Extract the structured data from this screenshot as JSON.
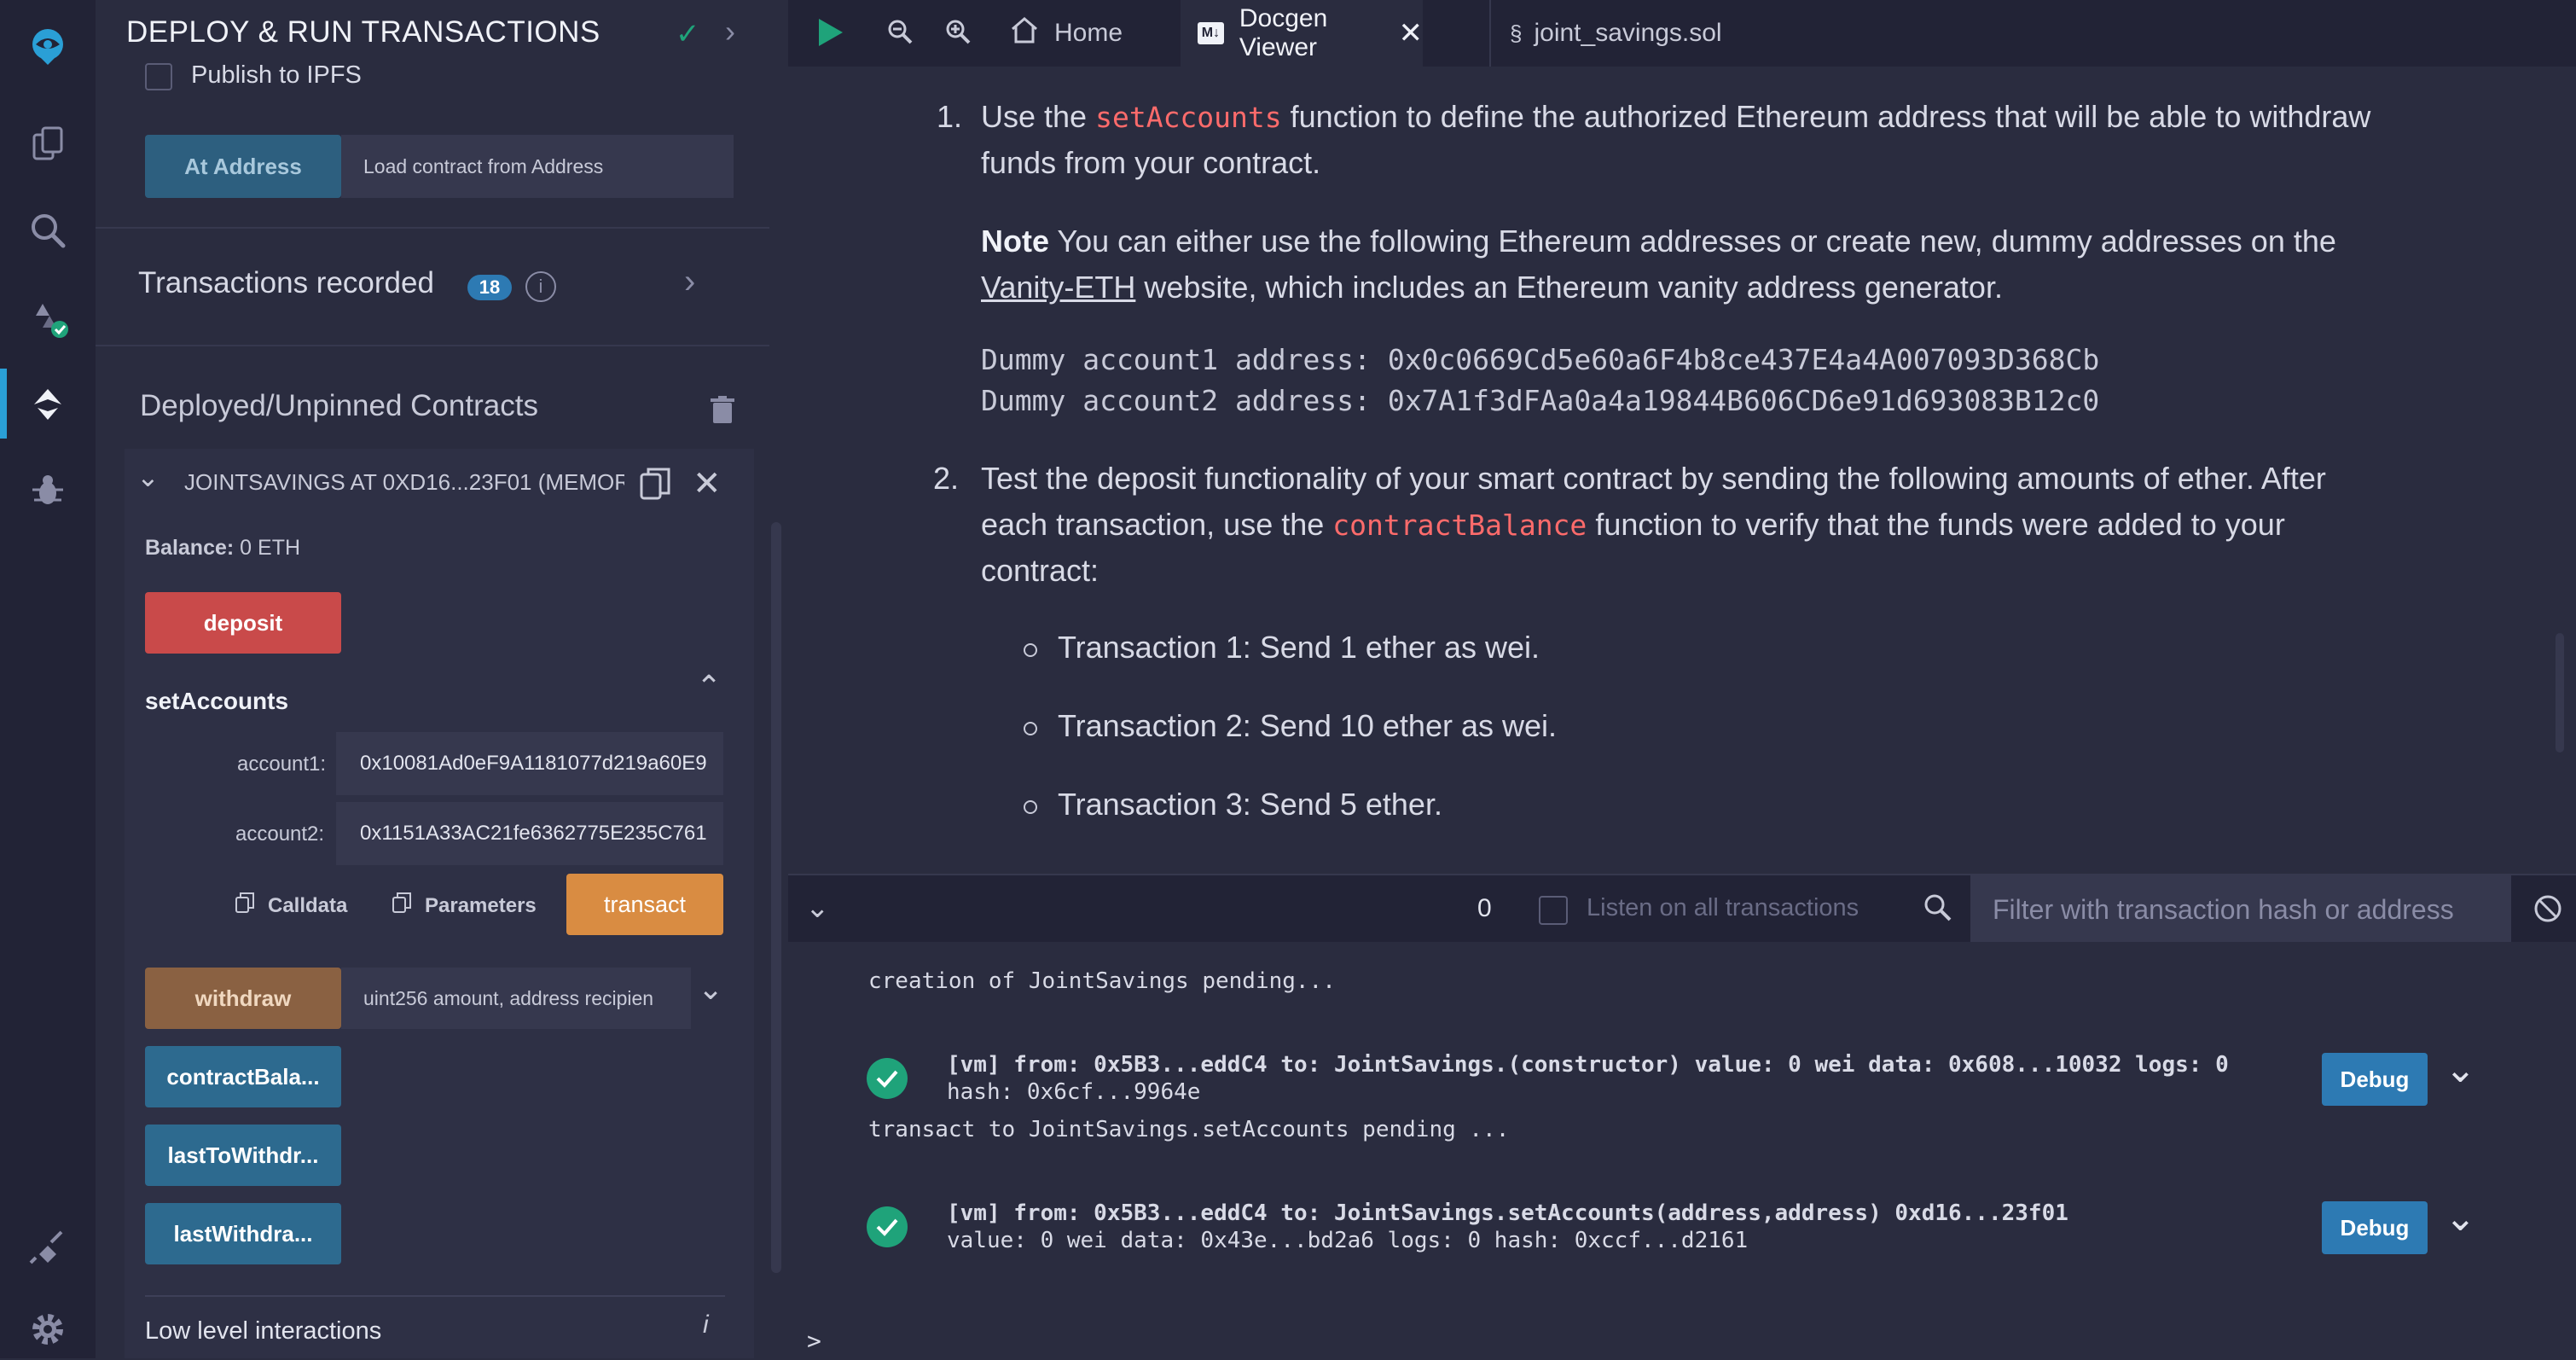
{
  "colors": {
    "accent": "#2a9fd6",
    "danger": "#c94a4a",
    "warning": "#d98c42",
    "success": "#1fa37a",
    "code": "#ff6b6b"
  },
  "rail": {
    "icons": [
      "remix-logo-icon",
      "file-explorer-icon",
      "search-icon",
      "solidity-compiler-icon",
      "deploy-run-icon",
      "debugger-icon",
      "plugin-manager-icon",
      "settings-icon"
    ]
  },
  "panel": {
    "title": "DEPLOY & RUN TRANSACTIONS",
    "publish_ipfs": "Publish to IPFS",
    "at_address_button": "At Address",
    "at_address_placeholder": "Load contract from Address",
    "transactions_recorded": "Transactions recorded",
    "transactions_count": "18",
    "deployed_title": "Deployed/Unpinned Contracts",
    "instance_title": "JOINTSAVINGS AT 0XD16...23F01 (MEMOR",
    "balance_label": "Balance:",
    "balance_value": "0 ETH",
    "deposit_button": "deposit",
    "set_accounts_title": "setAccounts",
    "account1_label": "account1:",
    "account1_value": "0x10081Ad0eF9A1181077d219a60E9",
    "account2_label": "account2:",
    "account2_value": "0x1151A33AC21fe6362775E235C761",
    "calldata_label": "Calldata",
    "parameters_label": "Parameters",
    "transact_button": "transact",
    "withdraw_button": "withdraw",
    "withdraw_placeholder": "uint256 amount, address recipien",
    "contract_balance_button": "contractBala...",
    "last_to_withdraw_button": "lastToWithdr...",
    "last_withdraw_button": "lastWithdra...",
    "low_level_label": "Low level interactions"
  },
  "tabs": [
    {
      "label": "Home",
      "icon": "home-icon"
    },
    {
      "label": "Docgen Viewer",
      "icon": "markdown-icon"
    },
    {
      "label": "joint_savings.sol",
      "icon": "solidity-file-icon"
    }
  ],
  "doc": {
    "item1_num": "1.",
    "item1_pre": "Use the",
    "item1_code": "setAccounts",
    "item1_post": "function to define the authorized Ethereum address that will be able to withdraw",
    "item1_line2": "funds from your contract.",
    "note_bold": "Note",
    "note_text": "You can either use the following Ethereum addresses or create new, dummy addresses on the",
    "note_link": "Vanity-ETH",
    "note_text2": "website, which includes an Ethereum vanity address generator.",
    "dummy1": "Dummy account1 address: 0x0c0669Cd5e60a6F4b8ce437E4a4A007093D368Cb",
    "dummy2": "Dummy account2 address: 0x7A1f3dFAa0a4a19844B606CD6e91d693083B12c0",
    "item2_num": "2.",
    "item2_line1": "Test the deposit functionality of your smart contract by sending the following amounts of ether. After",
    "item2_pre": "each transaction, use the",
    "item2_code": "contractBalance",
    "item2_post": "function to verify that the funds were added to your",
    "item2_line3": "contract:",
    "tx1": "Transaction 1: Send 1 ether as wei.",
    "tx2": "Transaction 2: Send 10 ether as wei.",
    "tx3": "Transaction 3: Send 5 ether."
  },
  "terminal": {
    "count": "0",
    "listen_label": "Listen on all transactions",
    "filter_placeholder": "Filter with transaction hash or address",
    "line_pending1": "creation of JointSavings pending...",
    "tx1_line1": "[vm]  from: 0x5B3...eddC4 to: JointSavings.(constructor) value: 0 wei data: 0x608...10032 logs: 0",
    "tx1_line2": "hash: 0x6cf...9964e",
    "line_pending2": "transact to JointSavings.setAccounts pending ...",
    "tx2_line1": "[vm]  from: 0x5B3...eddC4 to: JointSavings.setAccounts(address,address) 0xd16...23f01",
    "tx2_line2": "value: 0 wei data: 0x43e...bd2a6 logs: 0 hash: 0xccf...d2161",
    "debug_label": "Debug",
    "prompt": ">"
  }
}
